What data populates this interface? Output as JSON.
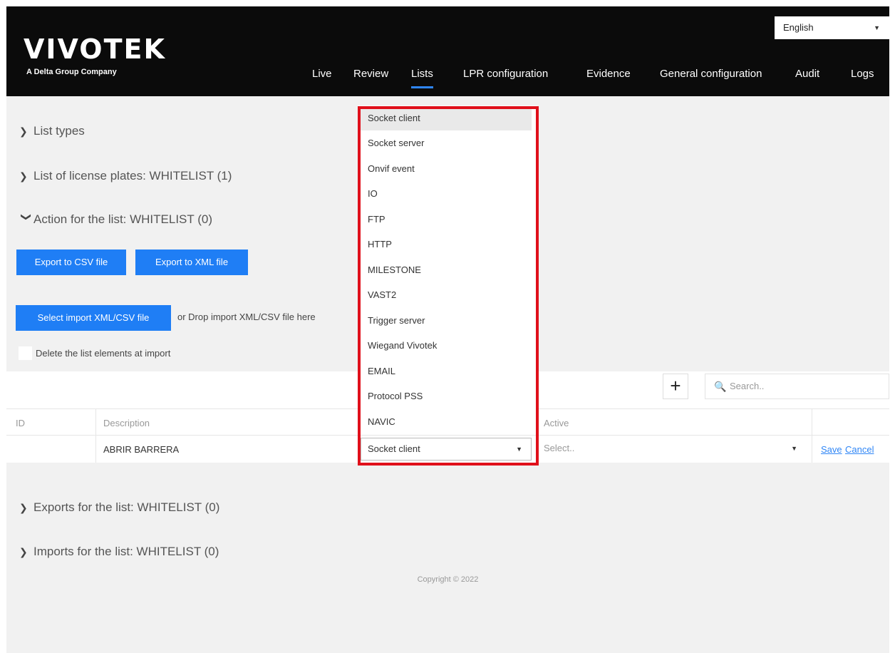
{
  "header": {
    "logo": "VIVOTEK",
    "tagline": "A Delta Group Company",
    "language": "English",
    "nav": [
      "Live",
      "Review",
      "Lists",
      "LPR configuration",
      "Evidence",
      "General configuration",
      "Audit",
      "Logs"
    ],
    "active_nav": "Lists"
  },
  "sections": {
    "list_types": "List types",
    "license_plates": "List of license plates: WHITELIST (1)",
    "action": "Action for the list: WHITELIST (0)",
    "exports": "Exports for the list: WHITELIST (0)",
    "imports": "Imports for the list: WHITELIST (0)"
  },
  "buttons": {
    "export_csv": "Export to CSV file",
    "export_xml": "Export to XML file",
    "select_import": "Select import XML/CSV file",
    "drop_text": "or Drop import XML/CSV file here",
    "delete_checkbox": "Delete the list elements at import"
  },
  "table": {
    "search_placeholder": "Search..",
    "headers": {
      "id": "ID",
      "description": "Description",
      "active": "Active"
    },
    "row": {
      "description": "ABRIR BARRERA",
      "type": "Socket client",
      "active_placeholder": "Select..",
      "save": "Save",
      "cancel": "Cancel"
    }
  },
  "dropdown": {
    "options": [
      "Socket client",
      "Socket server",
      "Onvif event",
      "IO",
      "FTP",
      "HTTP",
      "MILESTONE",
      "VAST2",
      "Trigger server",
      "Wiegand Vivotek",
      "EMAIL",
      "Protocol PSS",
      "NAVIC"
    ],
    "highlighted_index": 0
  },
  "footer": {
    "copyright": "Copyright © 2022"
  },
  "colors": {
    "accent": "#1f7ef5",
    "highlight_box": "#e0101b",
    "header_bg": "#0b0b0b"
  }
}
